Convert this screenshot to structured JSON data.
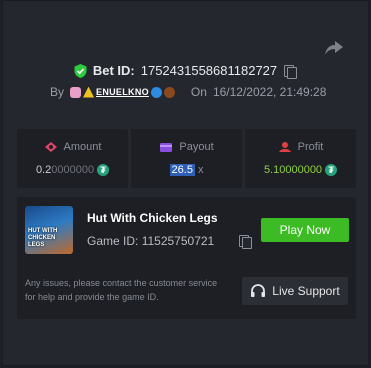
{
  "bet": {
    "label": "Bet ID:",
    "id": "1752431558681182727"
  },
  "by": {
    "prefix": "By",
    "username": "ENUELKNO",
    "on_label": "On",
    "datetime": "16/12/2022, 21:49:28"
  },
  "stats": {
    "amount": {
      "label": "Amount",
      "value_main": "0.2",
      "value_trail": "0000000",
      "currency_icon": "tether-icon"
    },
    "payout": {
      "label": "Payout",
      "value": "26.5",
      "suffix": "x"
    },
    "profit": {
      "label": "Profit",
      "value": "5.10000000",
      "currency_icon": "tether-icon"
    }
  },
  "game": {
    "title": "Hut With Chicken Legs",
    "thumb_text": "HUT WITH CHICKEN LEGS",
    "id_label": "Game ID:",
    "id": "11525750721",
    "play_label": "Play Now",
    "note": "Any issues, please contact the customer service for help and provide the game ID.",
    "support_label": "Live Support"
  },
  "colors": {
    "accent_green": "#3dbb24",
    "amount_icon": "#e0466a",
    "payout_icon": "#8a4fe0",
    "profit_icon": "#e04040",
    "profit_text": "#8fd13d",
    "shield": "#2ecc40"
  }
}
